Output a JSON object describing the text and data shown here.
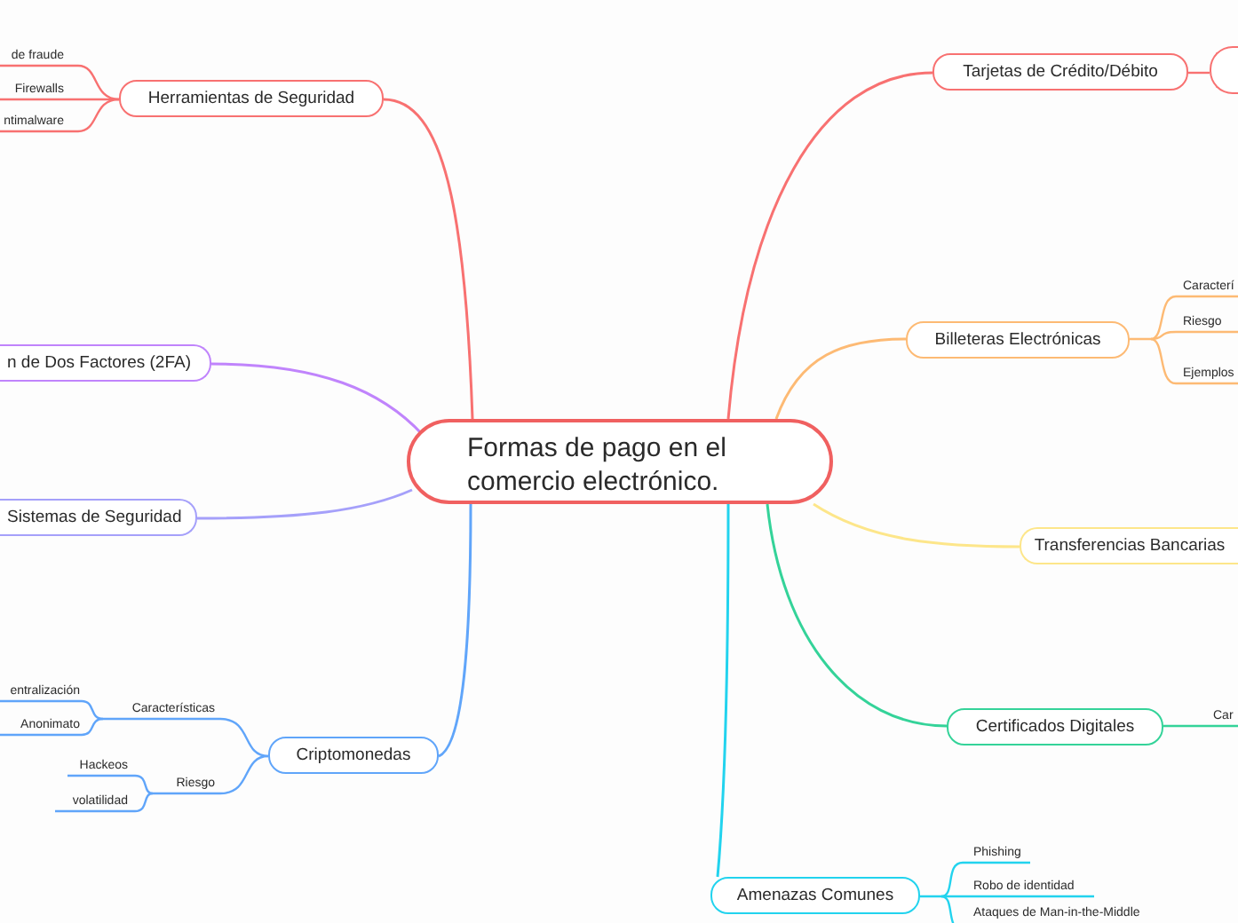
{
  "central_topic": {
    "label": "Formas de pago en el comercio electrónico."
  },
  "topics": [
    {
      "label": "Herramientas de Seguridad",
      "color": "#f87171",
      "children": [
        {
          "label": "de fraude"
        },
        {
          "label": "Firewalls"
        },
        {
          "label": "ntimalware"
        }
      ]
    },
    {
      "label": "n de Dos Factores (2FA)",
      "color": "#c084fc"
    },
    {
      "label": "Sistemas de Seguridad",
      "color": "#a5a0fa"
    },
    {
      "label": "Criptomonedas",
      "color": "#60a5fa",
      "children": [
        {
          "label": "Características",
          "children": [
            {
              "label": "entralización"
            },
            {
              "label": "Anonimato"
            }
          ]
        },
        {
          "label": "Riesgo",
          "children": [
            {
              "label": "Hackeos"
            },
            {
              "label": "volatilidad"
            }
          ]
        }
      ]
    },
    {
      "label": "Tarjetas de Crédito/Débito",
      "color": "#f87171",
      "children": [
        {
          "kind": "empty_node"
        }
      ]
    },
    {
      "label": "Billeteras Electrónicas",
      "color": "#fdba74",
      "children": [
        {
          "label": "Caracterí"
        },
        {
          "label": "Riesgo"
        },
        {
          "label": "Ejemplos"
        }
      ]
    },
    {
      "label": "Transferencias Bancarias",
      "color": "#fde68a"
    },
    {
      "label": "Certificados Digitales",
      "color": "#34d399",
      "children": [
        {
          "label": "Car"
        }
      ]
    },
    {
      "label": "Amenazas Comunes",
      "color": "#22d3ee",
      "children": [
        {
          "label": "Phishing"
        },
        {
          "label": "Robo de identidad"
        },
        {
          "label": "Ataques de Man-in-the-Middle"
        }
      ]
    }
  ]
}
